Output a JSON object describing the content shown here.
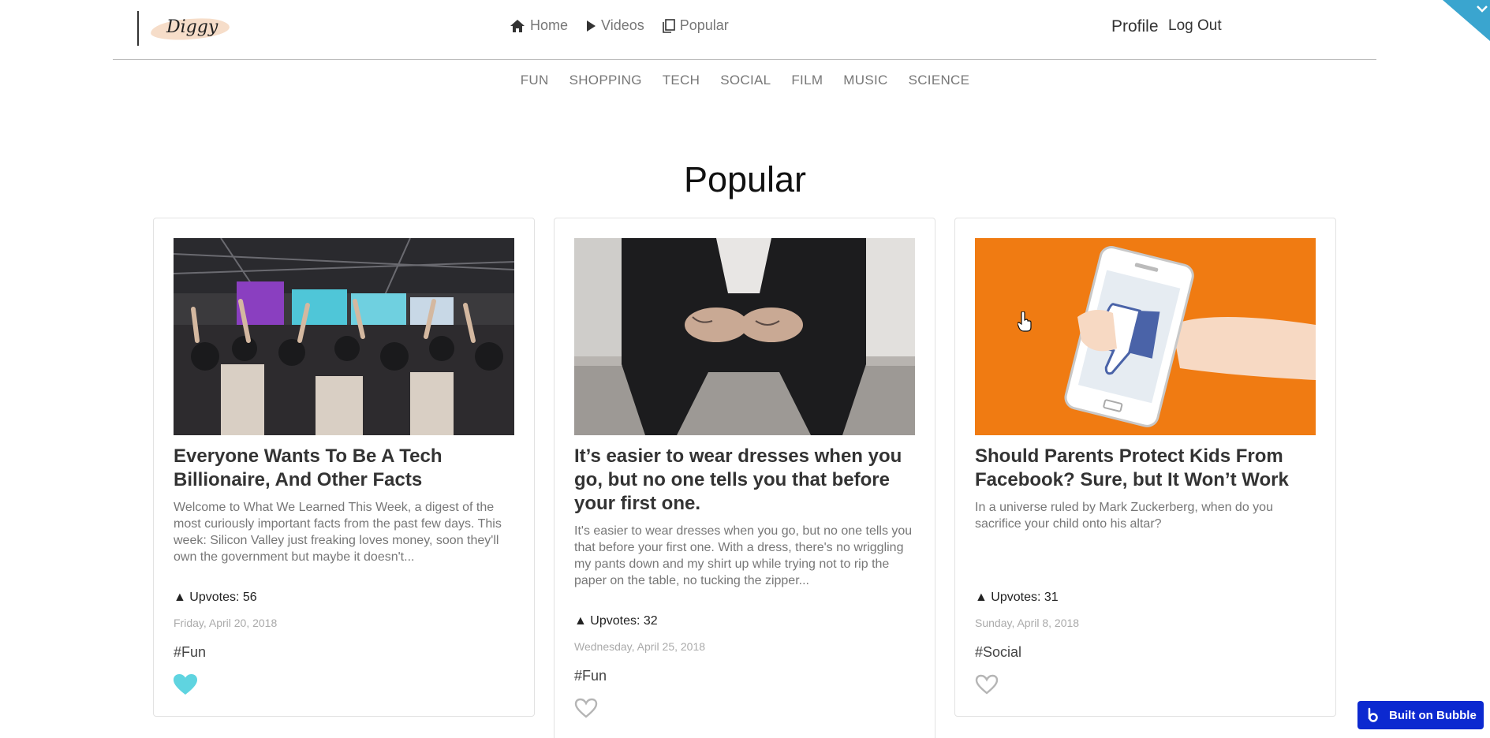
{
  "brand": {
    "logo_text": "Diggy"
  },
  "nav": {
    "home": "Home",
    "videos": "Videos",
    "popular": "Popular"
  },
  "account": {
    "profile": "Profile",
    "logout": "Log Out"
  },
  "categories": [
    "FUN",
    "SHOPPING",
    "TECH",
    "SOCIAL",
    "FILM",
    "MUSIC",
    "SCIENCE"
  ],
  "page_title": "Popular",
  "cards": [
    {
      "title": "Everyone Wants To Be A Tech Billionaire, And Other Facts",
      "description": "Welcome to What We Learned This Week, a digest of the most curiously important facts from the past few days. This week: Silicon Valley just freaking loves money, soon they'll own the government but maybe it doesn't...",
      "upvotes": "▲ Upvotes: 56",
      "date": "Friday, April 20, 2018",
      "tag": "#Fun",
      "liked": true,
      "image": "conference-crowd-photo"
    },
    {
      "title": " It’s easier to wear dresses when you go, but no one tells you that before your first one.",
      "description": "It's easier to wear dresses when you go, but no one tells you that before your first one. With a dress, there's no wriggling my pants down and my shirt up while trying not to rip the paper on the table, no tucking the zipper...",
      "upvotes": "▲ Upvotes: 32",
      "date": "Wednesday, April 25, 2018",
      "tag": "#Fun",
      "liked": false,
      "image": "seated-man-hands-photo"
    },
    {
      "title": "Should Parents Protect Kids From Facebook? Sure, but It Won’t Work",
      "description": "In a universe ruled by Mark Zuckerberg, when do you sacrifice your child onto his altar?",
      "upvotes": "▲ Upvotes: 31",
      "date": "Sunday, April 8, 2018",
      "tag": "#Social",
      "liked": false,
      "image": "phone-thumbs-down-illustration"
    }
  ],
  "badge": {
    "label": "Built on Bubble"
  },
  "colors": {
    "liked_heart": "#5fd4e0",
    "unliked_heart": "#b5b5b5",
    "badge_bg": "#0c29d0",
    "corner_tab": "#3aa5cf",
    "card3_bg": "#f07b12"
  }
}
